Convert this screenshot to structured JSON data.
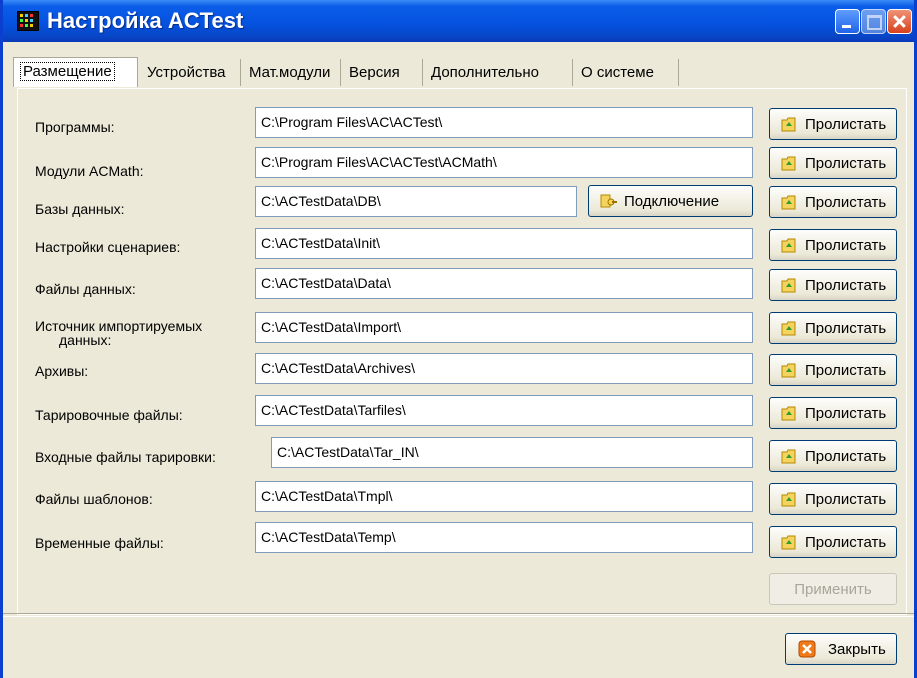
{
  "window": {
    "title": "Настройка ACTest"
  },
  "tabs": [
    {
      "label": "Размещение"
    },
    {
      "label": "Устройства"
    },
    {
      "label": "Мат.модули"
    },
    {
      "label": "Версия"
    },
    {
      "label": "Дополнительно"
    },
    {
      "label": "О системе"
    }
  ],
  "rows": [
    {
      "label": "Программы:",
      "value": "C:\\Program Files\\AC\\ACTest\\"
    },
    {
      "label": "Модули ACMath:",
      "value": "C:\\Program Files\\AC\\ACTest\\ACMath\\"
    },
    {
      "label": "Базы данных:",
      "value": "C:\\ACTestData\\DB\\"
    },
    {
      "label": "Настройки сценариев:",
      "value": "C:\\ACTestData\\Init\\"
    },
    {
      "label": "Файлы данных:",
      "value": "C:\\ACTestData\\Data\\"
    },
    {
      "label": "Источник импортируемых",
      "label2": "данных:",
      "value": "C:\\ACTestData\\Import\\"
    },
    {
      "label": "Архивы:",
      "value": "C:\\ACTestData\\Archives\\"
    },
    {
      "label": "Тарировочные файлы:",
      "value": "C:\\ACTestData\\Tarfiles\\"
    },
    {
      "label": "Входные файлы тарировки:",
      "value": "C:\\ACTestData\\Tar_IN\\"
    },
    {
      "label": "Файлы шаблонов:",
      "value": "C:\\ACTestData\\Tmpl\\"
    },
    {
      "label": "Временные файлы:",
      "value": "C:\\ACTestData\\Temp\\"
    }
  ],
  "buttons": {
    "browse": "Пролистать",
    "connect": "Подключение",
    "apply": "Применить",
    "close": "Закрыть"
  }
}
